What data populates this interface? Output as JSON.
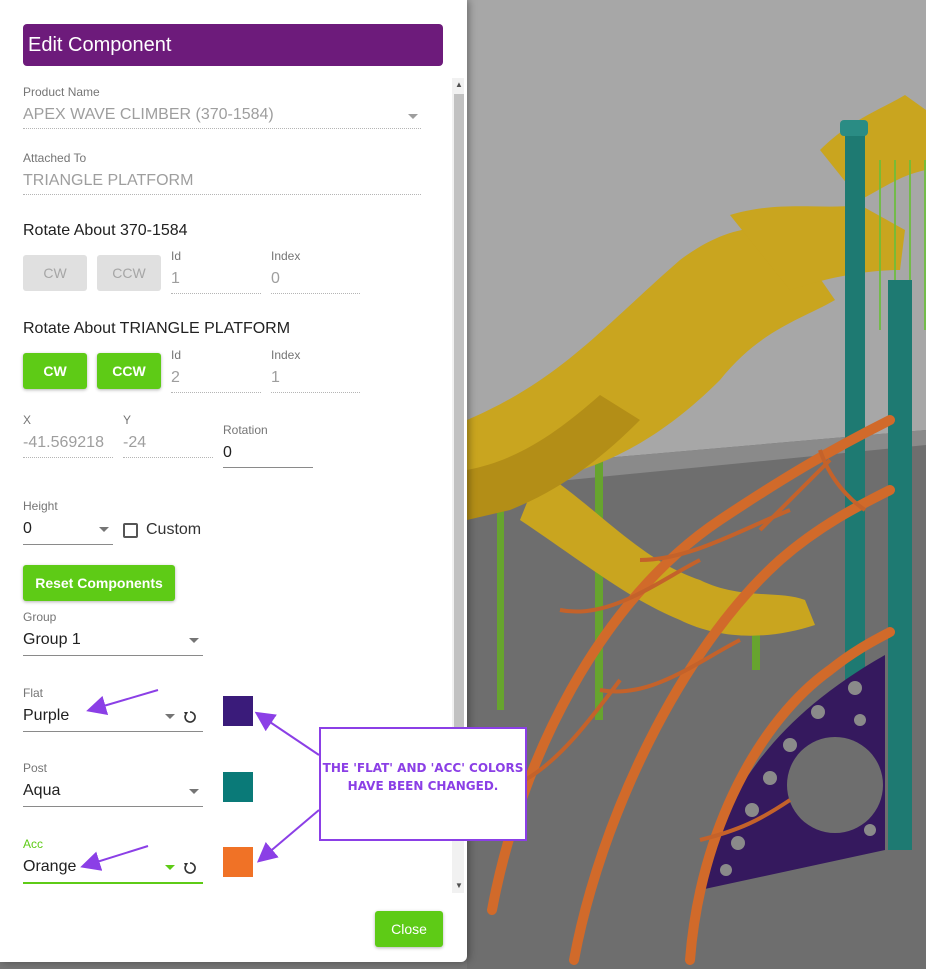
{
  "dialog": {
    "title": "Edit Component",
    "close_label": "Close"
  },
  "product": {
    "label": "Product Name",
    "value": "APEX WAVE CLIMBER (370-1584)"
  },
  "attached": {
    "label": "Attached To",
    "value": "TRIANGLE PLATFORM"
  },
  "rotate1": {
    "title": "Rotate About 370-1584",
    "cw": "CW",
    "ccw": "CCW",
    "id_label": "Id",
    "id_value": "1",
    "index_label": "Index",
    "index_value": "0"
  },
  "rotate2": {
    "title": "Rotate About TRIANGLE PLATFORM",
    "cw": "CW",
    "ccw": "CCW",
    "id_label": "Id",
    "id_value": "2",
    "index_label": "Index",
    "index_value": "1"
  },
  "position": {
    "x_label": "X",
    "x_value": "-41.569218",
    "y_label": "Y",
    "y_value": "-24",
    "rotation_label": "Rotation",
    "rotation_value": "0"
  },
  "height": {
    "label": "Height",
    "value": "0",
    "custom_label": "Custom",
    "custom_checked": false
  },
  "reset_label": "Reset Components",
  "group": {
    "label": "Group",
    "value": "Group 1"
  },
  "colors": {
    "flat": {
      "label": "Flat",
      "value": "Purple",
      "swatch": "#3a1b7a"
    },
    "post": {
      "label": "Post",
      "value": "Aqua",
      "swatch": "#0a7a78"
    },
    "acc": {
      "label": "Acc",
      "value": "Orange",
      "swatch": "#f07226"
    }
  },
  "annotation": {
    "text": "THE 'FLAT' AND 'ACC' COLORS HAVE BEEN CHANGED.",
    "color": "#8b3fe6"
  },
  "theme": {
    "accent": "#6d1b7b",
    "button": "#5ecb16"
  }
}
